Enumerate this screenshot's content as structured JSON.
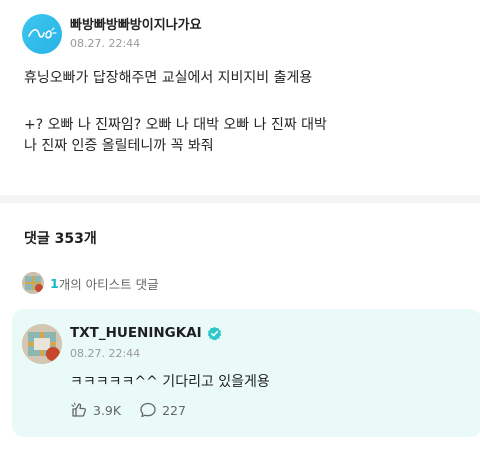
{
  "post": {
    "author": "빠방빠방빠방이지나가요",
    "timestamp": "08.27. 22:44",
    "text_line1": "휴닝오빠가 답장해주면 교실에서 지비지비 출게용",
    "text_line2": "+? 오빠 나 진짜임? 오빠 나 대박 오빠 나 진짜 대박",
    "text_line3": "나 진짜 인증 올릴테니까 꼭 봐줘"
  },
  "comments": {
    "count_label": "댓글 353개",
    "artist_count": "1",
    "artist_label": "개의 아티스트 댓글"
  },
  "artist_comment": {
    "name": "TXT_HUENINGKAI",
    "timestamp": "08.27. 22:44",
    "text": "ㅋㅋㅋㅋㅋ^^ 기다리고 있을게용",
    "likes": "3.9K",
    "replies": "227"
  },
  "colors": {
    "accent": "#12b8c9",
    "card_bg": "#eafaf9",
    "verified": "#2fc7c9"
  }
}
